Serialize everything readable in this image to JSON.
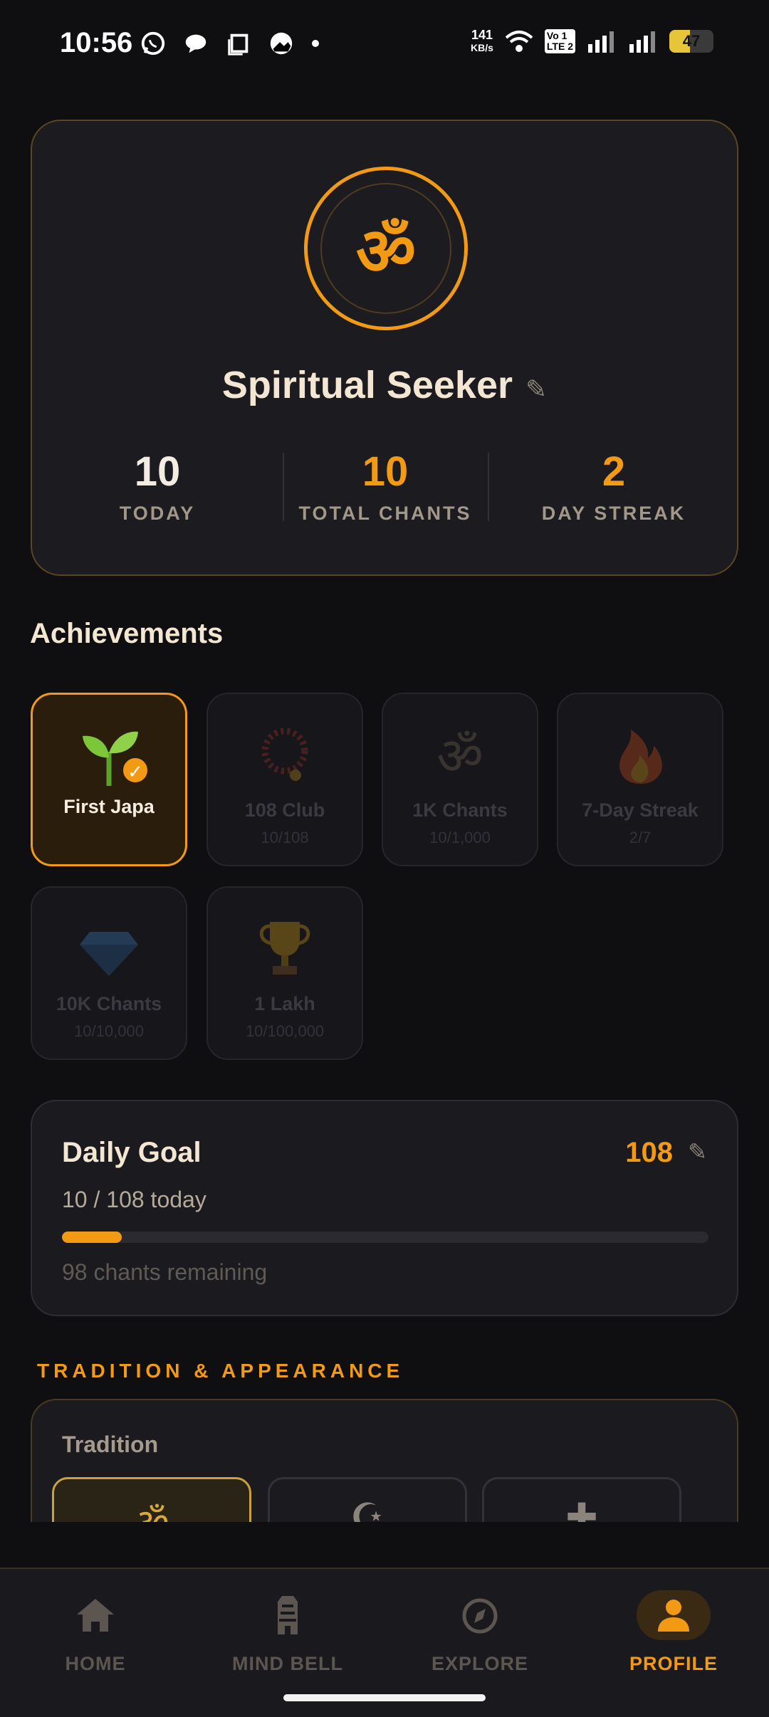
{
  "status_bar": {
    "time": "10:56",
    "net_speed_value": "141",
    "net_speed_unit": "KB/s",
    "volte_top": "Vo 1",
    "volte_bottom": "LTE 2",
    "battery": "47"
  },
  "profile": {
    "avatar_symbol": "ॐ",
    "name": "Spiritual Seeker",
    "edit_icon": "✎",
    "stats": [
      {
        "value": "10",
        "label": "TODAY"
      },
      {
        "value": "10",
        "label": "TOTAL CHANTS"
      },
      {
        "value": "2",
        "label": "DAY STREAK"
      }
    ]
  },
  "achievements": {
    "title": "Achievements",
    "items": [
      {
        "icon": "seedling-icon",
        "name": "First Japa",
        "progress": "",
        "unlocked": true
      },
      {
        "icon": "prayer-beads-icon",
        "name": "108 Club",
        "progress": "10/108",
        "unlocked": false
      },
      {
        "icon": "om-icon",
        "name": "1K Chants",
        "progress": "10/1,000",
        "unlocked": false
      },
      {
        "icon": "fire-icon",
        "name": "7-Day Streak",
        "progress": "2/7",
        "unlocked": false
      },
      {
        "icon": "gem-icon",
        "name": "10K Chants",
        "progress": "10/10,000",
        "unlocked": false
      },
      {
        "icon": "trophy-icon",
        "name": "1 Lakh",
        "progress": "10/100,000",
        "unlocked": false
      }
    ]
  },
  "daily_goal": {
    "title": "Daily Goal",
    "target": "108",
    "today_text": "10 / 108 today",
    "remaining_text": "98 chants remaining",
    "progress_fraction": 0.0926
  },
  "tradition": {
    "section_label": "TRADITION & APPEARANCE",
    "label": "Tradition",
    "options": [
      {
        "glyph": "ॐ",
        "selected": true
      },
      {
        "glyph": "☪",
        "selected": false
      },
      {
        "glyph": "✚",
        "selected": false
      }
    ]
  },
  "nav": {
    "items": [
      {
        "label": "HOME",
        "icon": "home-icon"
      },
      {
        "label": "MIND BELL",
        "icon": "temple-icon"
      },
      {
        "label": "EXPLORE",
        "icon": "compass-icon"
      },
      {
        "label": "PROFILE",
        "icon": "person-icon",
        "active": true
      }
    ]
  },
  "colors": {
    "accent": "#f39a14",
    "background": "#0f0f11",
    "card": "#1c1b20"
  }
}
